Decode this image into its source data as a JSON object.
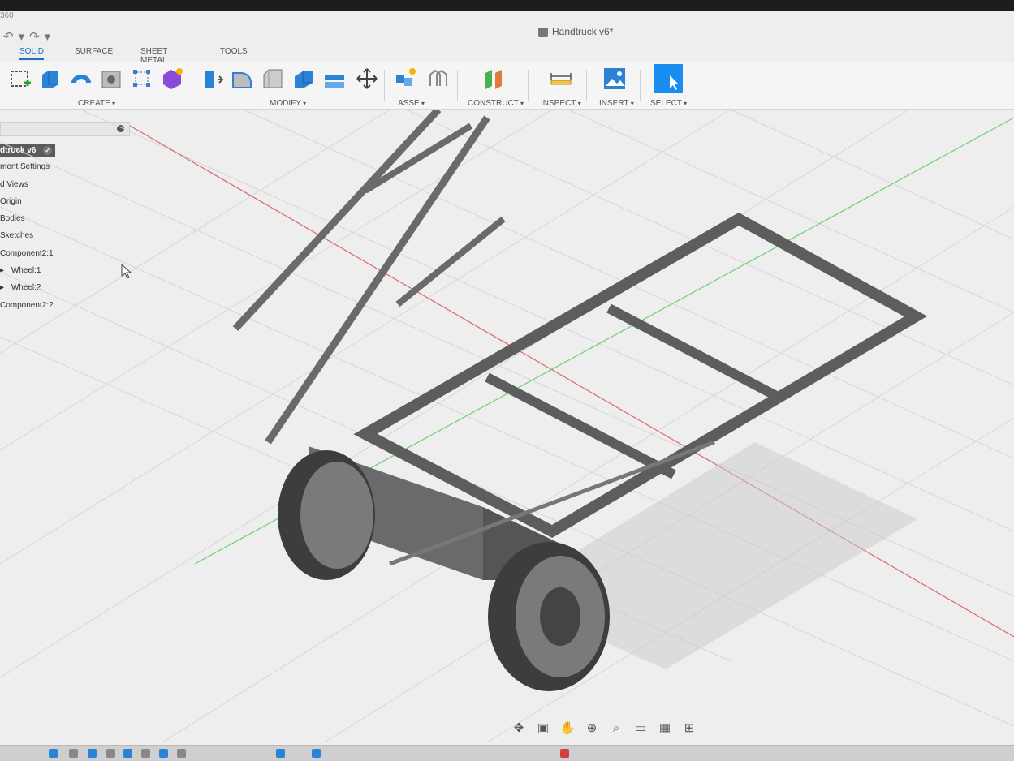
{
  "app": {
    "label": "360",
    "document_title": "Handtruck v6*"
  },
  "tabs": [
    {
      "label": "SOLID",
      "active": true
    },
    {
      "label": "SURFACE",
      "active": false
    },
    {
      "label": "SHEET METAL",
      "active": false
    },
    {
      "label": "TOOLS",
      "active": false
    }
  ],
  "toolbar": {
    "create_label": "CREATE",
    "modify_label": "MODIFY",
    "assemble_label": "ASSE",
    "construct_label": "CONSTRUCT",
    "inspect_label": "INSPECT",
    "insert_label": "INSERT",
    "select_label": "SELECT"
  },
  "browser": {
    "root": "dtruck v6",
    "items": [
      "ment Settings",
      "d Views",
      "Origin",
      "Bodies",
      "Sketches",
      "Component2:1",
      "Wheel:1",
      "Wheel:2",
      "Component2:2"
    ]
  },
  "colors": {
    "accent": "#1f70c1",
    "select_blue": "#1a8ef0",
    "model_gray": "#6f6f6f",
    "grid": "#d4d4d4",
    "x_axis": "#e06666",
    "y_axis": "#6fcf6f"
  },
  "icons": {
    "nav_bar": [
      "orbit-icon",
      "look-at-icon",
      "pan-hand-icon",
      "zoom-icon",
      "fit-icon",
      "display-icon",
      "grid-icon",
      "viewports-icon"
    ]
  }
}
